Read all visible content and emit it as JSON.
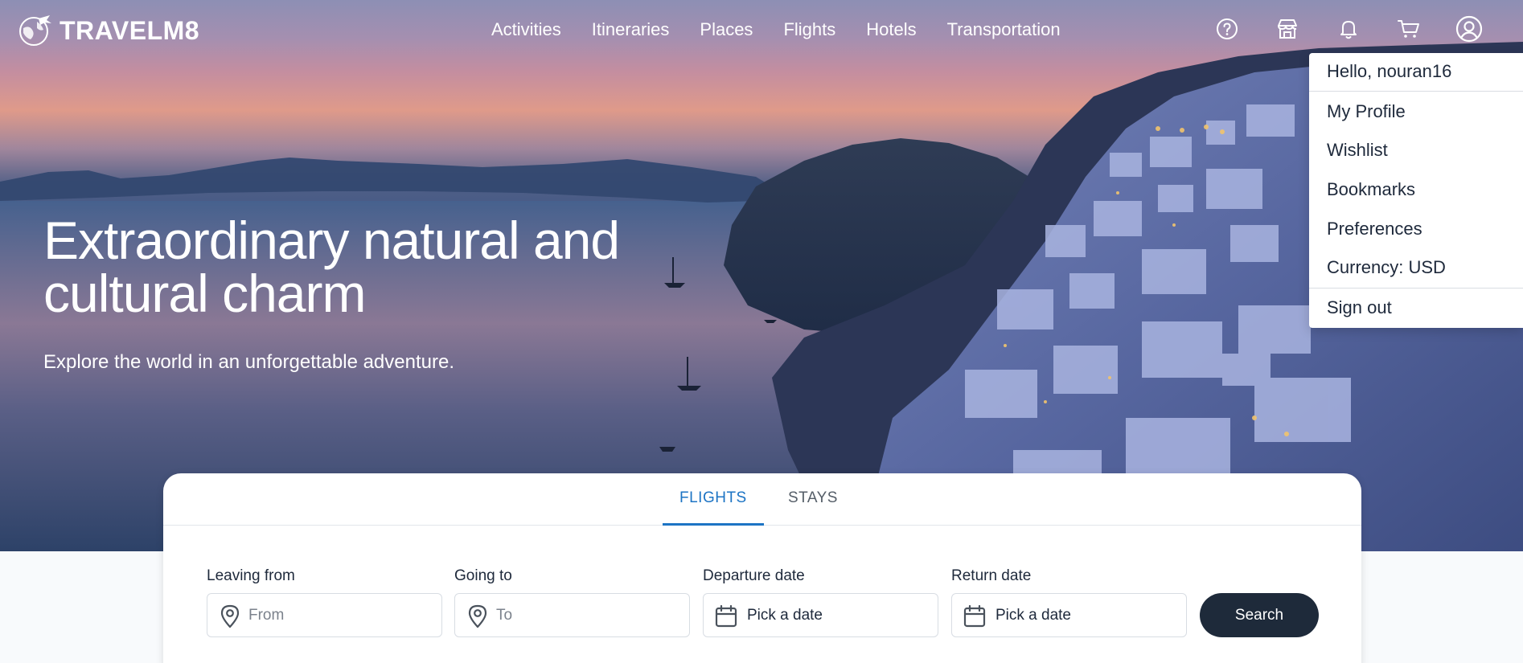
{
  "brand": {
    "name": "TRAVELM8",
    "logo_icon": "globe-plane-icon"
  },
  "nav": {
    "links": [
      "Activities",
      "Itineraries",
      "Places",
      "Flights",
      "Hotels",
      "Transportation"
    ],
    "icons": [
      "help-icon",
      "store-icon",
      "bell-icon",
      "cart-icon",
      "user-circle-icon"
    ]
  },
  "hero": {
    "title": "Extraordinary natural and cultural charm",
    "subtitle": "Explore the world in an unforgettable adventure."
  },
  "user_menu": {
    "greeting": "Hello, nouran16",
    "items": [
      "My Profile",
      "Wishlist",
      "Bookmarks",
      "Preferences",
      "Currency: USD"
    ],
    "sign_out": "Sign out"
  },
  "search": {
    "tabs": [
      "FLIGHTS",
      "STAYS"
    ],
    "active_tab": "FLIGHTS",
    "fields": {
      "leaving_from": {
        "label": "Leaving from",
        "placeholder": "From",
        "icon": "map-pin-icon"
      },
      "going_to": {
        "label": "Going to",
        "placeholder": "To",
        "icon": "map-pin-icon"
      },
      "departure": {
        "label": "Departure date",
        "value": "Pick a date",
        "icon": "calendar-icon"
      },
      "return": {
        "label": "Return date",
        "value": "Pick a date",
        "icon": "calendar-icon"
      }
    },
    "button_label": "Search"
  },
  "colors": {
    "accent": "#1d74c4",
    "button": "#1e2a3a",
    "text": "#1e293b"
  }
}
